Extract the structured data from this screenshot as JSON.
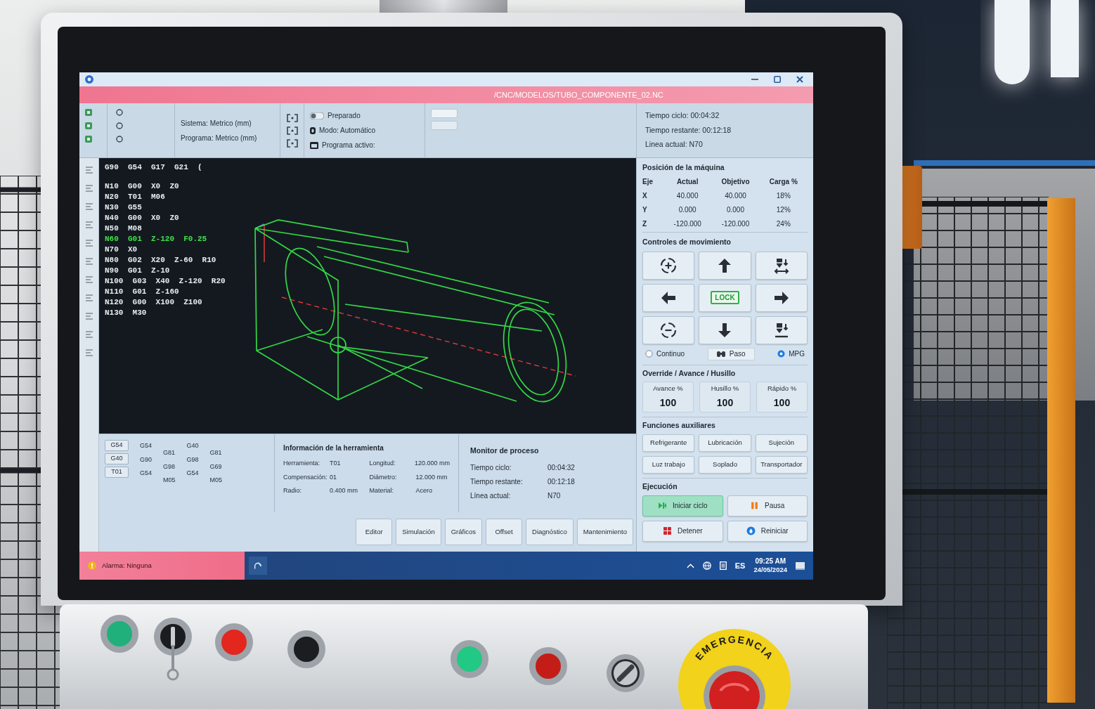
{
  "window": {
    "path": "/CNC/MODELOS/TUBO_COMPONENTE_02.NC"
  },
  "toolbar": {
    "settings": [
      "Sistema: Metrico (mm)",
      "Programa: Metrico (mm)"
    ],
    "status": [
      {
        "kind": "toggle",
        "text": "Preparado"
      },
      {
        "kind": "mode",
        "text": "Modo: Automático"
      },
      {
        "kind": "program",
        "text": "Programa activo:"
      }
    ],
    "times": [
      "Tiempo ciclo: 00:04:32",
      "Tiempo restante: 00:12:18",
      "Linea actual: N70"
    ]
  },
  "editor": {
    "lines": [
      {
        "text": "G90  G54  G17  G21  (",
        "selected": false
      },
      {
        "text": "N10  G00  X0  Z0",
        "selected": false
      },
      {
        "text": "N20  T01  M06",
        "selected": false
      },
      {
        "text": "N30  G55",
        "selected": false
      },
      {
        "text": "N40  G00  X0  Z0",
        "selected": false
      },
      {
        "text": "N50  M08",
        "selected": false
      },
      {
        "text": "N60  G01  Z-120  F0.25",
        "selected": true
      },
      {
        "text": "N70  X0",
        "selected": false
      },
      {
        "text": "N80  G02  X20  Z-60  R10",
        "selected": false
      },
      {
        "text": "N90  G01  Z-10",
        "selected": false
      },
      {
        "text": "N100  G03  X40  Z-120  R20",
        "selected": false
      },
      {
        "text": "N110  G01  Z-160",
        "selected": false
      },
      {
        "text": "N120  G00  X100  Z100",
        "selected": false
      },
      {
        "text": "N130  M30",
        "selected": false
      }
    ]
  },
  "modal_codes": {
    "buttons": [
      "G54",
      "G40",
      "T01"
    ],
    "columns": [
      [
        "G54",
        "G90",
        "G54"
      ],
      [
        "G81",
        "G98",
        "M05"
      ],
      [
        "G40",
        "G98",
        "G54"
      ],
      [
        "G81",
        "G69",
        "M05"
      ]
    ]
  },
  "tool_info": {
    "title": "Información de la herramienta",
    "fields": [
      {
        "label": "Herramienta:",
        "value": "T01"
      },
      {
        "label": "Longitud:",
        "value": "120.000 mm"
      },
      {
        "label": "Compensación:",
        "value": "01"
      },
      {
        "label": "Diámetro:",
        "value": "12.000 mm"
      },
      {
        "label": "Radio:",
        "value": "0.400 mm"
      },
      {
        "label": "Material:",
        "value": "Acero"
      }
    ]
  },
  "process_monitor": {
    "title": "Monitor de proceso",
    "fields": [
      {
        "label": "Tiempo ciclo:",
        "value": "00:04:32"
      },
      {
        "label": "Tiempo restante:",
        "value": "00:12:18"
      },
      {
        "label": "Línea actual:",
        "value": "N70"
      }
    ]
  },
  "tabs": [
    {
      "label": "Editor",
      "selected": false
    },
    {
      "label": "Simulación",
      "selected": false
    },
    {
      "label": "Gráficos",
      "selected": false
    },
    {
      "label": "Offset",
      "selected": false
    },
    {
      "label": "Diagnóstico",
      "selected": false
    },
    {
      "label": "Mantenimiento",
      "selected": false
    }
  ],
  "alarm": "Alarma: Ninguna",
  "machine_position": {
    "title": "Posición de la máquina",
    "columns": [
      "Eje",
      "Actual",
      "Objetivo",
      "Carga %"
    ],
    "rows": [
      [
        "X",
        "40.000",
        "40.000",
        "18%"
      ],
      [
        "Y",
        "0.000",
        "0.000",
        "12%"
      ],
      [
        "Z",
        "-120.000",
        "-120.000",
        "24%"
      ]
    ]
  },
  "motion_controls": {
    "title": "Controles de movimiento",
    "buttons": [
      {
        "kind": "rotate_plus"
      },
      {
        "kind": "up"
      },
      {
        "kind": "spindle_traverse"
      },
      {
        "kind": "left"
      },
      {
        "kind": "lock",
        "label": "LOCK"
      },
      {
        "kind": "right"
      },
      {
        "kind": "rotate_minus"
      },
      {
        "kind": "down"
      },
      {
        "kind": "spindle_down"
      }
    ],
    "modes": [
      {
        "kind": "radio",
        "label": "Continuo",
        "selected": false
      },
      {
        "kind": "button",
        "label": "Paso",
        "selected": false
      },
      {
        "kind": "radio",
        "label": "MPG",
        "selected": true
      }
    ]
  },
  "overrides": {
    "title": "Override / Avance / Husillo",
    "items": [
      {
        "label": "Avance %",
        "value": "100"
      },
      {
        "label": "Husillo %",
        "value": "100"
      },
      {
        "label": "Rápido %",
        "value": "100"
      }
    ]
  },
  "aux_functions": {
    "title": "Funciones auxiliares",
    "buttons": [
      "Refrigerante",
      "Lubricación",
      "Sujeción",
      "Luz trabajo",
      "Soplado",
      "Transportador"
    ]
  },
  "execution": {
    "title": "Ejecución",
    "buttons": [
      {
        "kind": "start",
        "label": "Iniciar ciclo",
        "active": true
      },
      {
        "kind": "pause",
        "label": "Pausa",
        "active": false
      },
      {
        "kind": "stop",
        "label": "Detener",
        "active": false
      },
      {
        "kind": "reset",
        "label": "Reiniciar",
        "active": false
      }
    ]
  },
  "taskbar": {
    "language": "ES",
    "time": "09:25 AM",
    "date": "24/05/2024"
  },
  "control_panel": {
    "buttons": [
      {
        "kind": "lamp",
        "color": "#1fb07c"
      },
      {
        "kind": "key",
        "on": false
      },
      {
        "kind": "lamp",
        "color": "#e3261e"
      },
      {
        "kind": "lamp",
        "color": "#1c1d20"
      },
      {
        "kind": "lamp",
        "color": "#22c984"
      },
      {
        "kind": "lamp",
        "color": "#c41d18"
      },
      {
        "kind": "selector",
        "on": true
      }
    ],
    "emergency_label": "EMERGENCIA"
  }
}
